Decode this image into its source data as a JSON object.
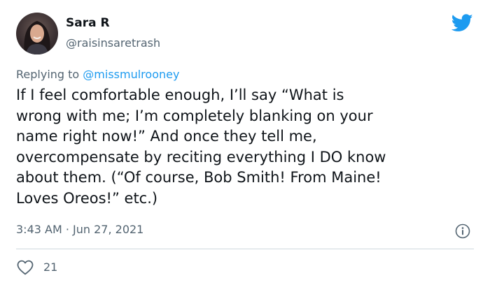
{
  "author": {
    "display_name": "Sara R",
    "handle": "@raisinsaretrash"
  },
  "reply": {
    "prefix": "Replying to ",
    "mention": "@missmulrooney"
  },
  "tweet": {
    "text": "If I feel comfortable enough, I’ll say “What is\nwrong with me; I’m completely blanking on your\nname right now!” And once they tell me,\novercompensate by reciting everything I DO know\nabout them. (“Of course, Bob Smith! From Maine!\nLoves Oreos!” etc.)",
    "timestamp": "3:43 AM · Jun 27, 2021"
  },
  "engagement": {
    "likes": "21"
  },
  "icons": {
    "brand": "twitter-bird-icon",
    "info": "info-icon",
    "like": "heart-icon"
  },
  "colors": {
    "brand": "#1d9bf0",
    "secondary_text": "#536471",
    "primary_text": "#0f1419",
    "divider": "#cfd9de"
  }
}
